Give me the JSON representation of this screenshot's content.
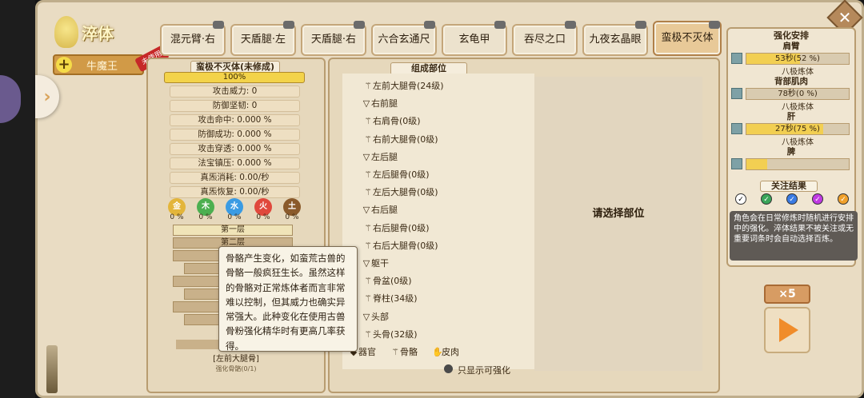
{
  "screen": {
    "title": "淬体",
    "character": {
      "plus_label": "+",
      "name": "牛魔王",
      "tag": "未使用"
    },
    "close_label": "✕",
    "tabs": [
      {
        "label": "混元臂·右",
        "active": false
      },
      {
        "label": "天盾腿·左",
        "active": false
      },
      {
        "label": "天盾腿·右",
        "active": false
      },
      {
        "label": "六合玄通尺",
        "active": false
      },
      {
        "label": "玄龟甲",
        "active": false
      },
      {
        "label": "吞尽之口",
        "active": false
      },
      {
        "label": "九夜玄晶眼",
        "active": false
      },
      {
        "label": "蛮极不灭体",
        "active": true
      }
    ]
  },
  "left_panel": {
    "header": "蛮极不灭体(未修成)",
    "progress_label": "100%",
    "progress_value": 1.0,
    "stats": [
      "攻击威力: 0",
      "防御坚韧: 0",
      "攻击命中: 0.000 %",
      "防御成功: 0.000 %",
      "攻击穿透: 0.000 %",
      "法宝镇压: 0.000 %",
      "真炁消耗: 0.00/秒",
      "真炁恢复: 0.00/秒"
    ],
    "elements": [
      {
        "label": "金",
        "pct": "0 %",
        "color": "#e3b53a"
      },
      {
        "label": "木",
        "pct": "0 %",
        "color": "#4caf50"
      },
      {
        "label": "水",
        "pct": "0 %",
        "color": "#3a9be3"
      },
      {
        "label": "火",
        "pct": "0 %",
        "color": "#e0483c"
      },
      {
        "label": "土",
        "pct": "0 %",
        "color": "#8a5a2b"
      }
    ],
    "layers": [
      "第一层",
      "第二层"
    ],
    "bottom_name": "[左前大腿骨]",
    "bottom_sub": "强化骨骼(0/1)"
  },
  "middle_panel": {
    "header": "组成部位",
    "tree": [
      {
        "type": "item",
        "label": "左前大腿骨(24级)"
      },
      {
        "type": "group",
        "label": "右前腿"
      },
      {
        "type": "item",
        "label": "右肩骨(0级)"
      },
      {
        "type": "item",
        "label": "右前大腿骨(0级)"
      },
      {
        "type": "group",
        "label": "左后腿"
      },
      {
        "type": "item",
        "label": "左后腿骨(0级)"
      },
      {
        "type": "item",
        "label": "左后大腿骨(0级)"
      },
      {
        "type": "group",
        "label": "右后腿"
      },
      {
        "type": "item",
        "label": "右后腿骨(0级)"
      },
      {
        "type": "item",
        "label": "右后大腿骨(0级)"
      },
      {
        "type": "group",
        "label": "躯干"
      },
      {
        "type": "item",
        "label": "骨盆(0级)"
      },
      {
        "type": "item",
        "label": "脊柱(34级)"
      },
      {
        "type": "group",
        "label": "头部"
      },
      {
        "type": "item",
        "label": "头骨(32级)"
      }
    ],
    "prompt": "请选择部位",
    "legend": [
      "器官",
      "骨骼",
      "皮肉"
    ],
    "only_show": "只显示可强化"
  },
  "tooltip": {
    "text": "骨骼产生变化，如蛮荒古兽的骨骼一般疯狂生长。虽然这样的骨骼对正常炼体者而言非常难以控制，但其威力也确实异常强大。此种变化在使用古兽骨粉强化精华时有更高几率获得。"
  },
  "right_panel": {
    "header": "强化安排",
    "arrangements": [
      {
        "name": "肩臂",
        "value": "53秒(52 %)",
        "fill": 0.52,
        "sub": "八极炼体"
      },
      {
        "name": "背部肌肉",
        "value": "78秒(0 %)",
        "fill": 0.0,
        "sub": "八极炼体"
      },
      {
        "name": "肝",
        "value": "27秒(75 %)",
        "fill": 0.75,
        "sub": "八极炼体"
      },
      {
        "name": "脾",
        "value": "",
        "fill": 0.2,
        "sub": ""
      }
    ],
    "focus_header": "关注结果",
    "focus_colors": [
      "#ffffff",
      "#3aa55a",
      "#3a7be3",
      "#c03ae3",
      "#f0a02a"
    ],
    "note": "角色会在日常修炼时随机进行安排中的强化。淬体结果不被关注或无重要词条时会自动选择百炼。",
    "multiplier": "×5"
  }
}
